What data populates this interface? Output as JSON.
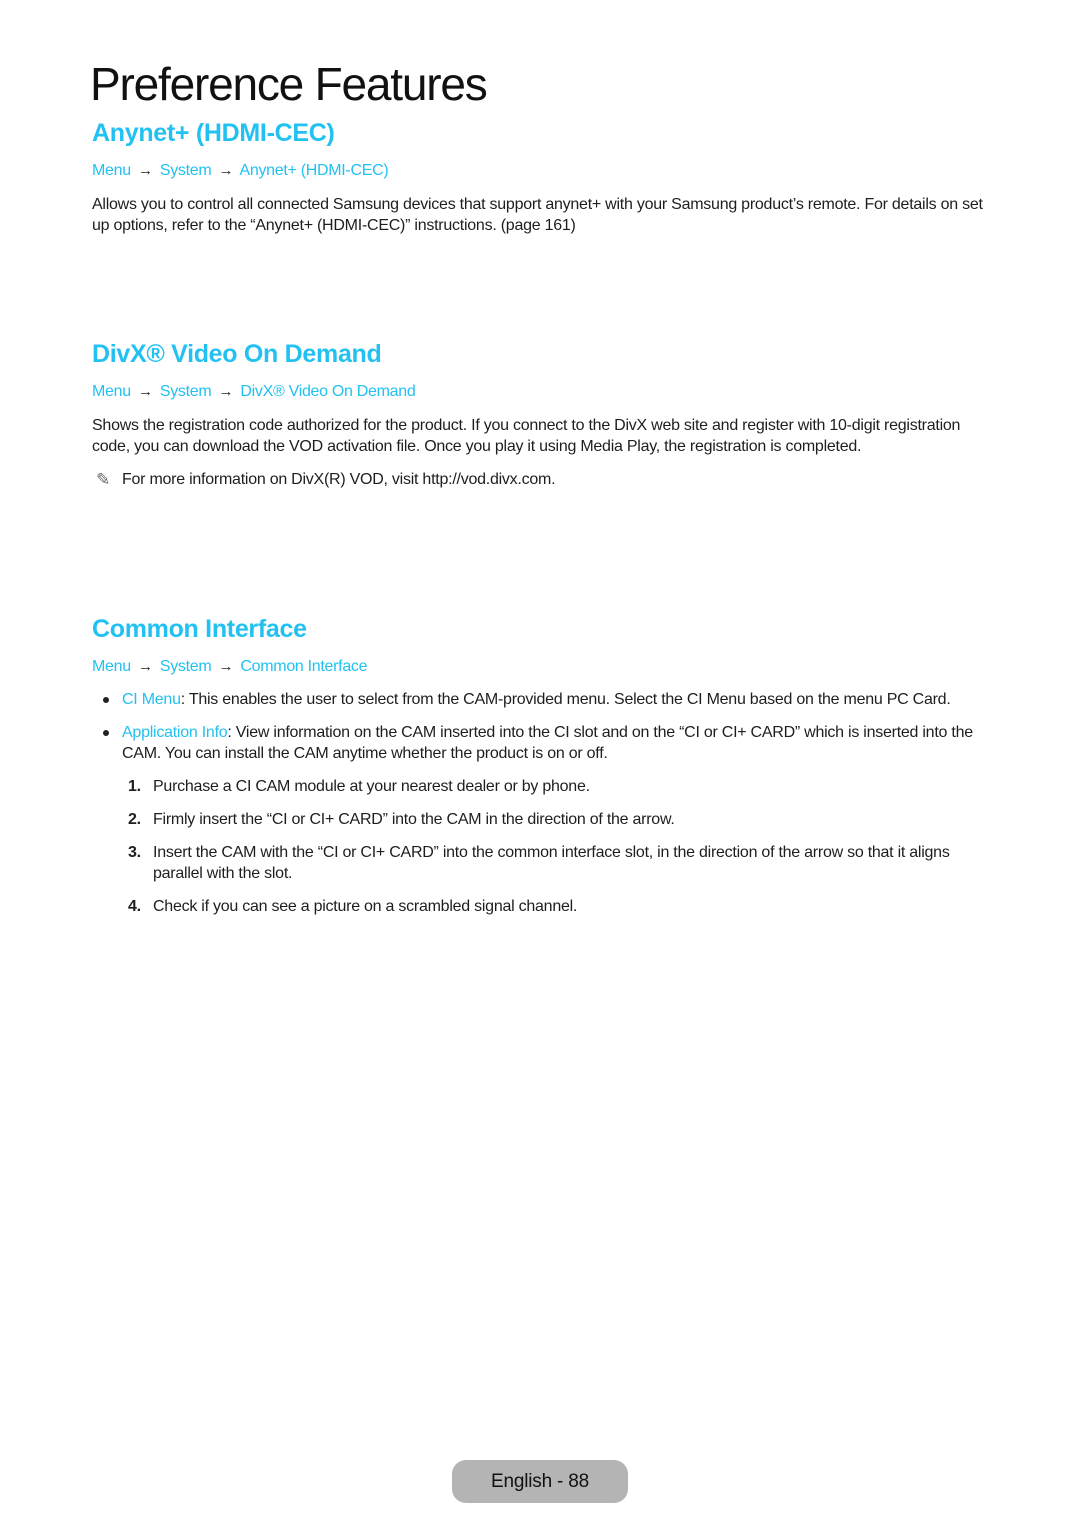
{
  "page": {
    "title": "Preference Features",
    "footer_badge": "English - 88"
  },
  "colors": {
    "accent": "#22c1f1",
    "text": "#1e1e1e",
    "badge_bg": "#b4b4b4"
  },
  "sections": [
    {
      "heading": "Anynet+ (HDMI-CEC)",
      "breadcrumb": [
        "Menu",
        "System",
        "Anynet+ (HDMI-CEC)"
      ],
      "arrow": "→",
      "body": "Allows you to control all connected Samsung devices that support anynet+ with your Samsung product’s remote. For details on set up options, refer to the “Anynet+ (HDMI-CEC)” instructions. (page 161)"
    },
    {
      "heading": "DivX® Video On Demand",
      "breadcrumb": [
        "Menu",
        "System",
        "DivX® Video On Demand"
      ],
      "arrow": "→",
      "body": "Shows the registration code authorized for the product. If you connect to the DivX web site and register with 10-digit registration code, you can download the VOD activation file. Once you play it using Media Play, the registration is completed.",
      "note_icon": "pencil-note-icon",
      "note": "For more information on DivX(R) VOD, visit http://vod.divx.com."
    },
    {
      "heading": "Common Interface",
      "breadcrumb": [
        "Menu",
        "System",
        "Common Interface"
      ],
      "arrow": "→",
      "bullets": [
        {
          "term": "CI Menu",
          "text": ": This enables the user to select from the CAM-provided menu. Select the CI Menu based on the menu PC Card."
        },
        {
          "term": "Application Info",
          "text": ": View information on the CAM inserted into the CI slot and on the “CI or CI+ CARD” which is inserted into the CAM. You can install the CAM anytime whether the product is on or off."
        }
      ],
      "steps": [
        {
          "num": "1.",
          "text": "Purchase a CI CAM module at your nearest dealer or by phone."
        },
        {
          "num": "2.",
          "text": "Firmly insert the “CI or CI+ CARD” into the CAM in the direction of the arrow."
        },
        {
          "num": "3.",
          "text": "Insert the CAM with the “CI or CI+ CARD” into the common interface slot, in the direction of the arrow so that it aligns parallel with the slot."
        },
        {
          "num": "4.",
          "text": "Check if you can see a picture on a scrambled signal channel."
        }
      ]
    }
  ]
}
